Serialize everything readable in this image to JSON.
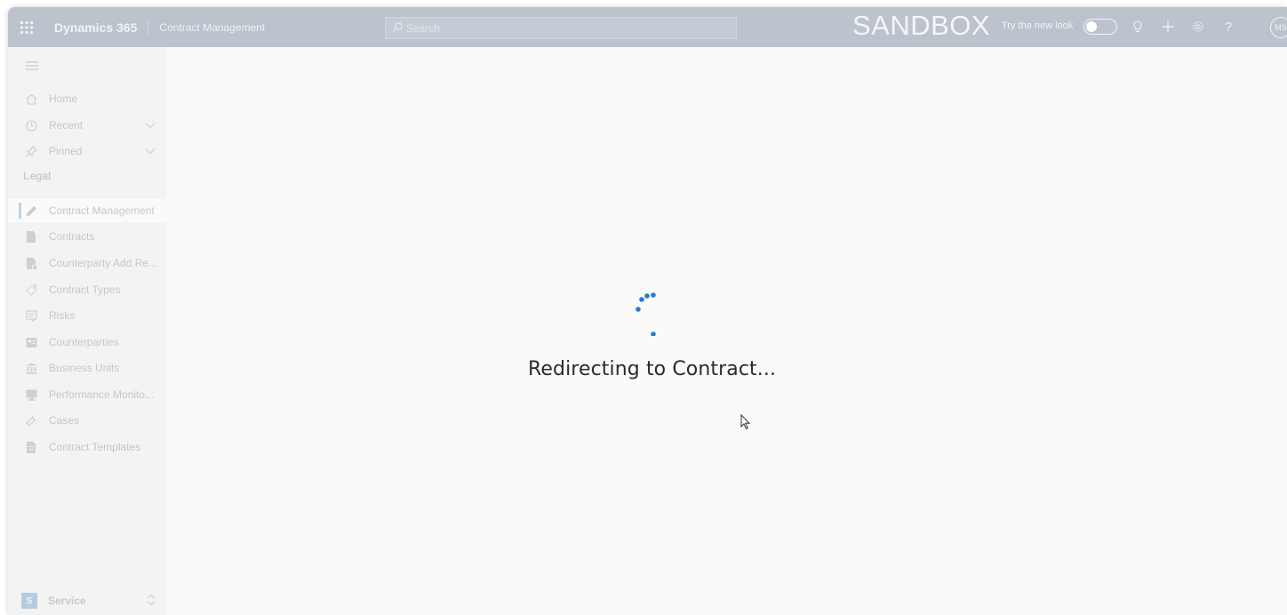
{
  "header": {
    "brand": "Dynamics 365",
    "app_name": "Contract Management",
    "search_placeholder": "Search",
    "environment": "SANDBOX",
    "try_new_look": "Try the new look",
    "avatar_initials": "MS",
    "icons": [
      "waffle-icon",
      "lightbulb-icon",
      "plus-icon",
      "gear-icon",
      "help-icon"
    ]
  },
  "sidebar": {
    "top_items": [
      {
        "label": "Home",
        "icon": "home-icon"
      },
      {
        "label": "Recent",
        "icon": "clock-icon"
      },
      {
        "label": "Pinned",
        "icon": "pin-icon"
      }
    ],
    "section": "Legal",
    "items": [
      {
        "label": "Contract Management",
        "icon": "pencil-icon",
        "active": true
      },
      {
        "label": "Contracts",
        "icon": "document-icon"
      },
      {
        "label": "Counterparty Add Re...",
        "icon": "document-add-icon"
      },
      {
        "label": "Contract Types",
        "icon": "tag-icon"
      },
      {
        "label": "Risks",
        "icon": "risk-icon"
      },
      {
        "label": "Counterparties",
        "icon": "contacts-icon"
      },
      {
        "label": "Business Units",
        "icon": "bank-icon"
      },
      {
        "label": "Performance Monito...",
        "icon": "monitor-icon"
      },
      {
        "label": "Cases",
        "icon": "wrench-icon"
      },
      {
        "label": "Contract Templates",
        "icon": "template-icon"
      }
    ],
    "area": {
      "initial": "S",
      "label": "Service"
    }
  },
  "main": {
    "loading_message": "Redirecting to Contract..."
  },
  "colors": {
    "topbar": "#bcc3cd",
    "spinner": "#2a7bc6",
    "active_indicator": "#b9d3ec"
  }
}
